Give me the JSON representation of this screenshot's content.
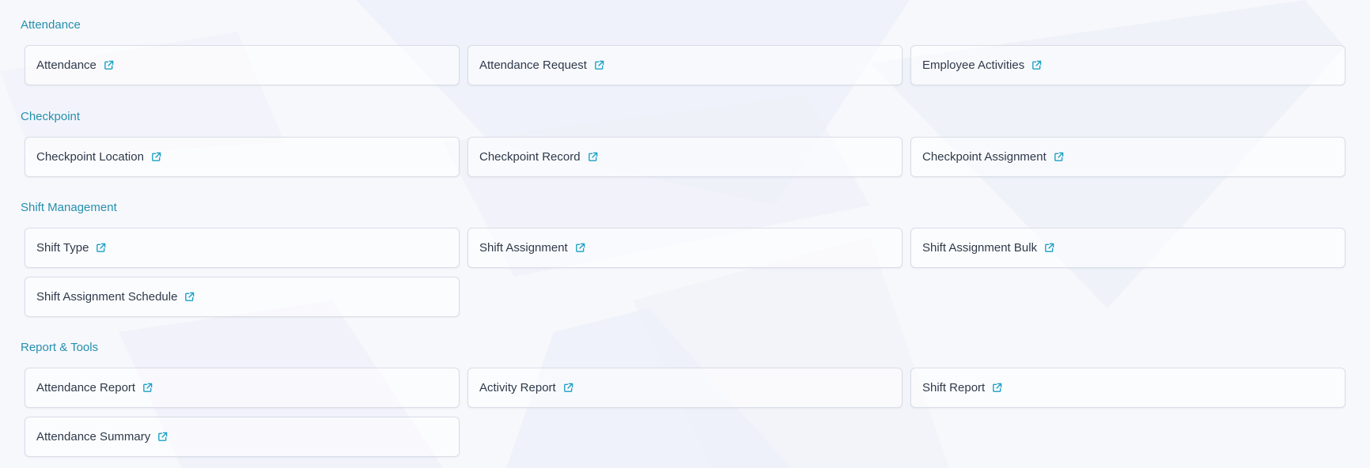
{
  "colors": {
    "section_title": "#2490ad",
    "card_text": "#2f3a4a",
    "icon": "#1ba0c4",
    "card_border": "#d9dde6",
    "background": "#f7f8fc"
  },
  "sections": [
    {
      "title": "Attendance",
      "items": [
        {
          "label": "Attendance",
          "icon": "external-link-icon"
        },
        {
          "label": "Attendance Request",
          "icon": "external-link-icon"
        },
        {
          "label": "Employee Activities",
          "icon": "external-link-icon"
        }
      ]
    },
    {
      "title": "Checkpoint",
      "items": [
        {
          "label": "Checkpoint Location",
          "icon": "external-link-icon"
        },
        {
          "label": "Checkpoint Record",
          "icon": "external-link-icon"
        },
        {
          "label": "Checkpoint Assignment",
          "icon": "external-link-icon"
        }
      ]
    },
    {
      "title": "Shift Management",
      "items": [
        {
          "label": "Shift Type",
          "icon": "external-link-icon"
        },
        {
          "label": "Shift Assignment",
          "icon": "external-link-icon"
        },
        {
          "label": "Shift Assignment Bulk",
          "icon": "external-link-icon"
        },
        {
          "label": "Shift Assignment Schedule",
          "icon": "external-link-icon"
        }
      ]
    },
    {
      "title": "Report & Tools",
      "items": [
        {
          "label": "Attendance Report",
          "icon": "external-link-icon"
        },
        {
          "label": "Activity Report",
          "icon": "external-link-icon"
        },
        {
          "label": "Shift Report",
          "icon": "external-link-icon"
        },
        {
          "label": "Attendance Summary",
          "icon": "external-link-icon"
        }
      ]
    }
  ]
}
